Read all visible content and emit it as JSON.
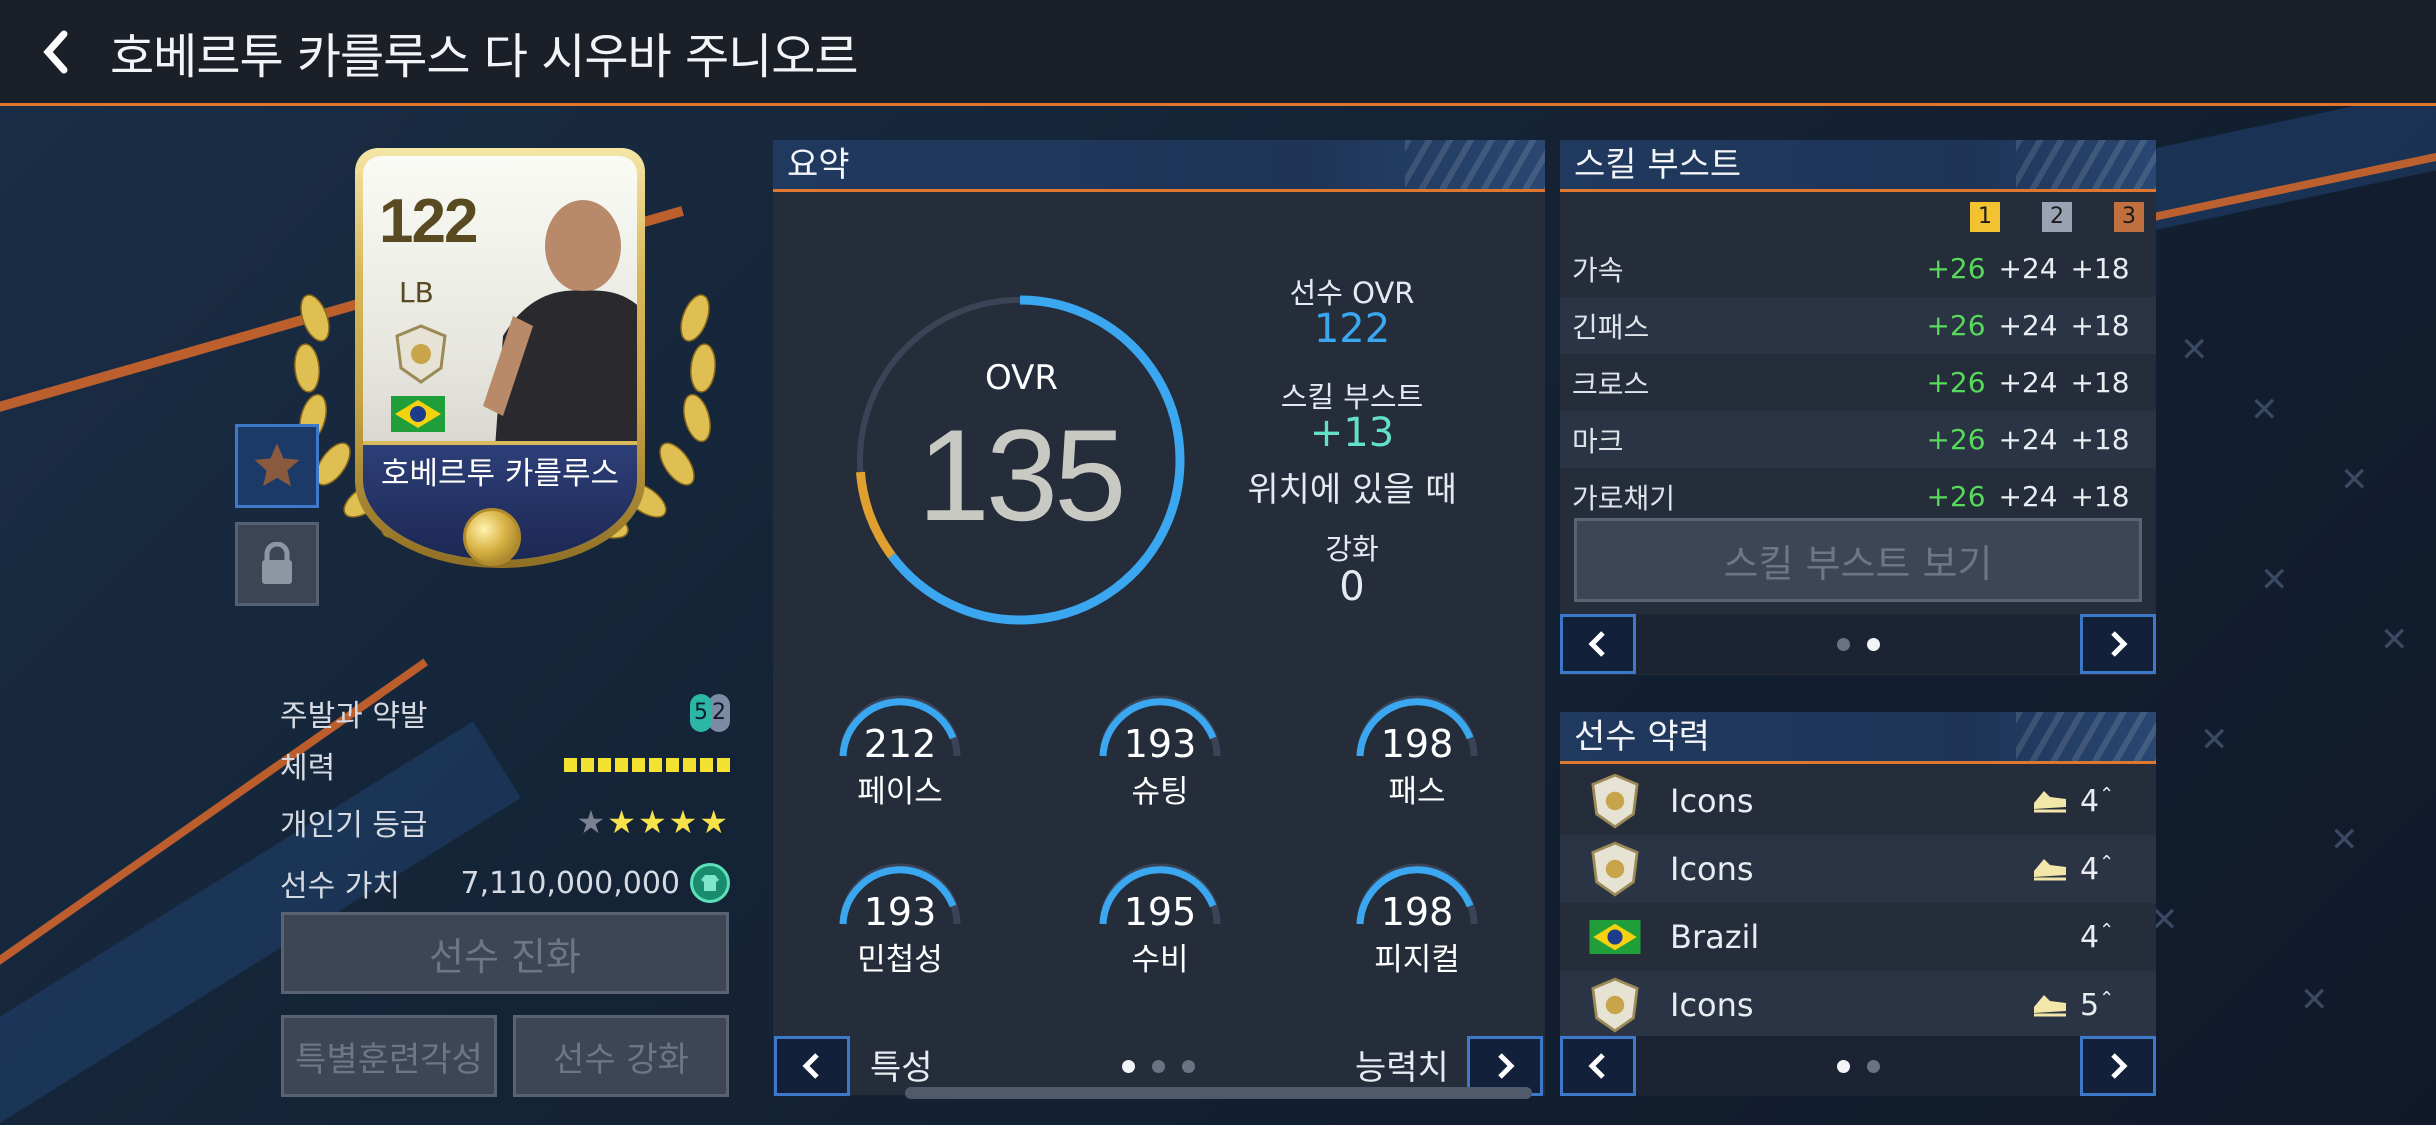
{
  "header": {
    "title": "호베르투 카를루스 다 시우바 주니오르"
  },
  "card": {
    "ovr": "122",
    "position": "LB",
    "name": "호베르투 카를루스"
  },
  "info": {
    "foot_label": "주발과 약발",
    "foot_strong": "5",
    "foot_weak": "2",
    "stamina_label": "체력",
    "stamina_level": 10,
    "popularity_label": "개인기 등급",
    "popularity_stars": 4,
    "popularity_max": 5,
    "value_label": "선수 가치",
    "value": "7,110,000,000"
  },
  "buttons": {
    "evolve": "선수 진화",
    "special_training": "특별훈련각성",
    "enhance": "선수 강화",
    "skill_boost_view": "스킬 부스트 보기"
  },
  "summary": {
    "title": "요약",
    "ovr_label": "OVR",
    "ovr_value": "135",
    "ovr_fraction": 0.9,
    "player_ovr_label": "선수 OVR",
    "player_ovr": "122",
    "skill_boost_label": "스킬 부스트",
    "skill_boost": "+13",
    "skill_boost_note": "위치에 있을 때",
    "enhance_label": "강화",
    "enhance_value": "0",
    "stats": [
      {
        "value": "212",
        "label": "페이스"
      },
      {
        "value": "193",
        "label": "슈팅"
      },
      {
        "value": "198",
        "label": "패스"
      },
      {
        "value": "193",
        "label": "민첩성"
      },
      {
        "value": "195",
        "label": "수비"
      },
      {
        "value": "198",
        "label": "피지컬"
      }
    ],
    "footer_left": "특성",
    "footer_right": "능력치",
    "page_dots": 3,
    "page_active": 0
  },
  "skill_boost": {
    "title": "스킬 부스트",
    "ranks": [
      "1",
      "2",
      "3"
    ],
    "rows": [
      {
        "name": "가속",
        "v1": "+26",
        "v2": "+24",
        "v3": "+18"
      },
      {
        "name": "긴패스",
        "v1": "+26",
        "v2": "+24",
        "v3": "+18"
      },
      {
        "name": "크로스",
        "v1": "+26",
        "v2": "+24",
        "v3": "+18"
      },
      {
        "name": "마크",
        "v1": "+26",
        "v2": "+24",
        "v3": "+18"
      },
      {
        "name": "가로채기",
        "v1": "+26",
        "v2": "+24",
        "v3": "+18"
      }
    ],
    "page_dots": 2,
    "page_active": 1
  },
  "chemistry": {
    "title": "선수 약력",
    "rows": [
      {
        "icon": "icons-badge-icon",
        "name": "Icons",
        "boot": true,
        "level": "4"
      },
      {
        "icon": "icons-badge-icon",
        "name": "Icons",
        "boot": true,
        "level": "4"
      },
      {
        "icon": "brazil-flag-icon",
        "name": "Brazil",
        "boot": false,
        "level": "4"
      },
      {
        "icon": "icons-badge-icon",
        "name": "Icons",
        "boot": true,
        "level": "5"
      }
    ],
    "page_dots": 2,
    "page_active": 0
  },
  "colors": {
    "accent": "#e0772e",
    "gauge_blue": "#3aa7f0",
    "gauge_orange": "#e0a030",
    "green": "#57d95b",
    "teal": "#62e0c8",
    "nav_border": "#3d78c9"
  }
}
